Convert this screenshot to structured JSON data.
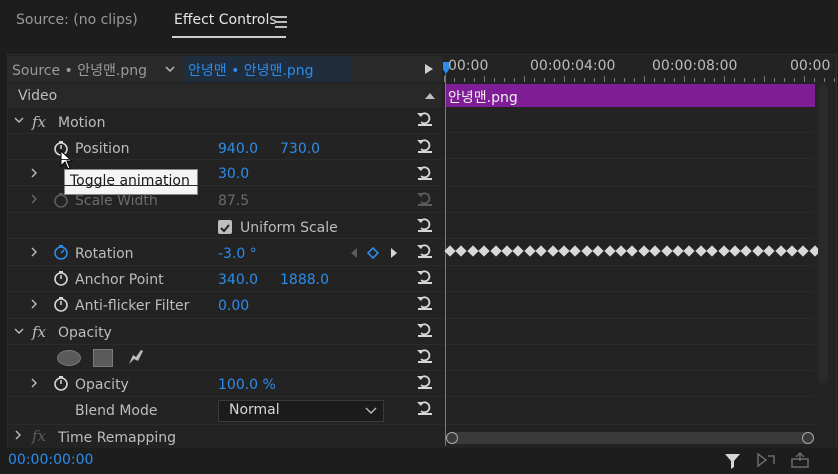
{
  "tabs": {
    "source": "Source: (no clips)",
    "effect_controls": "Effect Controls",
    "menu_icon": "hamburger-menu-icon"
  },
  "header": {
    "source_clip": "Source • 안녕맨.png",
    "sequence_clip": "안녕맨 • 안녕맨.png",
    "video_label": "Video"
  },
  "timeline": {
    "ruler": [
      "00:00",
      "00:00:04:00",
      "00:00:08:00",
      "00:00"
    ],
    "clip_label": "안녕맨.png",
    "clip_color": "#7f1d97",
    "playhead_color": "#2d8ceb"
  },
  "effects": {
    "motion_label": "Motion",
    "position_label": "Position",
    "position_x": "940.0",
    "position_y": "730.0",
    "scale_value": "30.0",
    "scale_width_label": "Scale Width",
    "scale_width_value": "87.5",
    "uniform_scale_label": "Uniform Scale",
    "rotation_label": "Rotation",
    "rotation_value": "-3.0 °",
    "anchor_label": "Anchor Point",
    "anchor_x": "340.0",
    "anchor_y": "1888.0",
    "antiflicker_label": "Anti-flicker Filter",
    "antiflicker_value": "0.00",
    "opacity_group_label": "Opacity",
    "opacity_label": "Opacity",
    "opacity_value": "100.0 %",
    "blend_label": "Blend Mode",
    "blend_value": "Normal",
    "time_remap_label": "Time Remapping"
  },
  "tooltip": {
    "text": "Toggle animation"
  },
  "footer": {
    "timecode": "00:00:00:00"
  },
  "colors": {
    "accent": "#2d8ceb",
    "background": "#1d1d1d",
    "panel": "#232323"
  }
}
